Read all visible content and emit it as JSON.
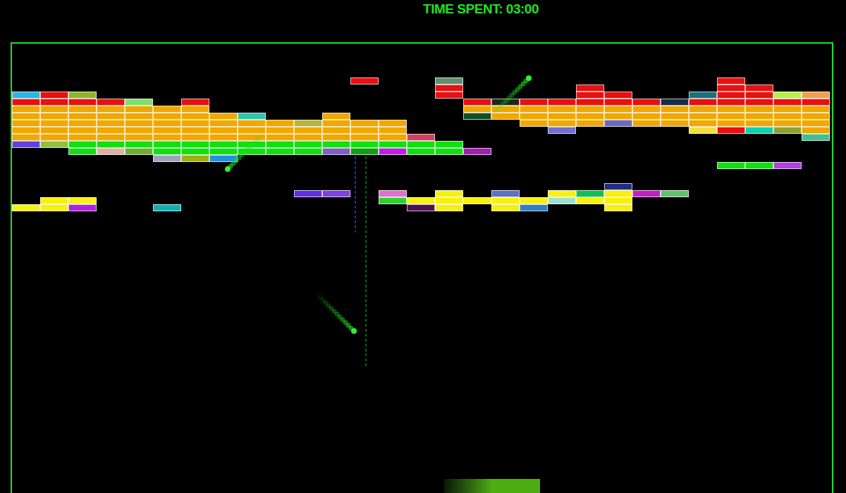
{
  "hud": {
    "time_label": "TIME SPENT: 03:00"
  },
  "bricks": [
    [
      null,
      null,
      null,
      null,
      null,
      null,
      null,
      null,
      null,
      null,
      null,
      null,
      "#e81010",
      null,
      null,
      "#5f8f6f",
      null,
      null,
      null,
      null,
      null,
      null,
      null,
      null,
      null,
      "#e81010",
      null,
      null,
      null
    ],
    [
      null,
      null,
      null,
      null,
      null,
      null,
      null,
      null,
      null,
      null,
      null,
      null,
      null,
      null,
      null,
      "#e81010",
      null,
      null,
      null,
      null,
      "#e81010",
      null,
      null,
      null,
      null,
      "#e81010",
      "#e81010",
      null,
      null
    ],
    [
      "#2cb5e0",
      "#e81010",
      "#8fb52a",
      null,
      null,
      null,
      null,
      null,
      null,
      null,
      null,
      null,
      null,
      null,
      null,
      "#e81010",
      null,
      null,
      null,
      null,
      "#e81010",
      "#e81010",
      null,
      null,
      "#1d6f7a",
      "#e81010",
      "#e81010",
      "#b5f04a",
      "#f0a050"
    ],
    [
      "#e81010",
      "#e81010",
      "#e81010",
      "#e81010",
      "#7ee06a",
      null,
      "#e81010",
      null,
      null,
      null,
      null,
      null,
      null,
      null,
      null,
      null,
      "#e81010",
      "#1a2a1a",
      "#e81010",
      "#e81010",
      "#e81010",
      "#e81010",
      "#e81010",
      "#1a2a4a",
      "#e81010",
      "#e81010",
      "#e81010",
      "#e81010",
      "#e81010"
    ],
    [
      "#f0a800",
      "#f0a800",
      "#f0a800",
      "#f0a800",
      "#f0a800",
      "#f0a800",
      "#f0a800",
      null,
      null,
      null,
      null,
      null,
      null,
      null,
      null,
      null,
      "#f0a800",
      "#f0a800",
      "#f0a800",
      "#f0a800",
      "#f0a800",
      "#f0a800",
      "#f0a800",
      "#f0a800",
      "#f0a800",
      "#f0a800",
      "#f0a800",
      "#f0a800",
      "#f0a800"
    ],
    [
      "#f0a800",
      "#f0a800",
      "#f0a800",
      "#f0a800",
      "#f0a800",
      "#f0a800",
      "#f0a800",
      "#f0a800",
      "#2ec4b0",
      null,
      null,
      "#f0a800",
      null,
      null,
      null,
      null,
      "#0f4f2a",
      "#f0a800",
      "#f0a800",
      "#f0a800",
      "#f0a800",
      "#f0a800",
      "#f0a800",
      "#f0a800",
      "#f0a800",
      "#f0a800",
      "#f0a800",
      "#f0a800",
      "#f0a800"
    ],
    [
      "#f0a800",
      "#f0a800",
      "#f0a800",
      "#f0a800",
      "#f0a800",
      "#f0a800",
      "#f0a800",
      "#f0a800",
      "#f0a800",
      "#f0a800",
      "#b5b53a",
      "#f0a800",
      "#f0a800",
      "#f0a800",
      null,
      null,
      null,
      null,
      "#f0a800",
      "#f0a800",
      "#f0a800",
      "#6a6aba",
      "#f0a800",
      "#f0a800",
      "#f0a800",
      "#f0a800",
      "#f0a800",
      "#f0a800",
      "#f0a800"
    ],
    [
      "#f0a800",
      "#f0a800",
      "#f0a800",
      "#f0a800",
      "#f0a800",
      "#f0a800",
      "#f0a800",
      "#f0a800",
      "#f0a800",
      "#f0a800",
      "#f0a800",
      "#f0a800",
      "#f0a800",
      "#f0a800",
      null,
      null,
      null,
      null,
      null,
      "#7070d0",
      null,
      null,
      null,
      null,
      "#f0e040",
      "#e81010",
      "#10d0b0",
      "#90a030",
      "#f0a800"
    ],
    [
      "#f0a800",
      "#f0a800",
      "#f0a800",
      "#f0a800",
      "#f0a800",
      "#f0a800",
      "#f0a800",
      "#f0a800",
      "#f0a800",
      "#f0a800",
      "#f0a800",
      "#f0a800",
      "#f0a800",
      "#f0a800",
      "#d04060",
      null,
      null,
      null,
      null,
      null,
      null,
      null,
      null,
      null,
      null,
      null,
      null,
      null,
      "#40c090"
    ],
    [
      "#6040e0",
      "#90c040",
      "#10e010",
      "#10e010",
      "#10e010",
      "#10e010",
      "#10e010",
      "#10e010",
      "#10e010",
      "#10e010",
      "#10e010",
      "#10e010",
      "#10e010",
      "#10e010",
      "#10e010",
      "#10e010",
      null,
      null,
      null,
      null,
      null,
      null,
      null,
      null,
      null,
      null,
      null,
      null,
      null
    ],
    [
      null,
      null,
      "#10e010",
      "#e0b0a0",
      "#70b030",
      "#10e010",
      "#10e010",
      "#10e010",
      "#10e010",
      "#10e010",
      "#10e010",
      "#8060c0",
      "#10a010",
      "#c020e0",
      "#10e010",
      "#10e010",
      "#a020b0",
      null,
      null,
      null,
      null,
      null,
      null,
      null,
      null,
      null,
      null,
      null,
      null
    ],
    [
      null,
      null,
      null,
      null,
      null,
      "#a0a0c0",
      "#a0b010",
      "#2090e0",
      null,
      null,
      null,
      null,
      null,
      null,
      null,
      null,
      null,
      null,
      null,
      null,
      null,
      null,
      null,
      null,
      null,
      null,
      null,
      null,
      null
    ],
    [
      null,
      null,
      null,
      null,
      null,
      null,
      null,
      null,
      null,
      null,
      null,
      null,
      null,
      null,
      null,
      null,
      null,
      null,
      null,
      null,
      null,
      null,
      null,
      null,
      null,
      "#10e010",
      "#10e010",
      "#b040e0",
      null
    ],
    [
      null,
      null,
      null,
      null,
      null,
      null,
      null,
      null,
      null,
      null,
      null,
      null,
      null,
      null,
      null,
      null,
      null,
      null,
      null,
      null,
      null,
      null,
      null,
      null,
      null,
      null,
      null,
      null,
      null
    ],
    [
      null,
      null,
      null,
      null,
      null,
      null,
      null,
      null,
      null,
      null,
      null,
      null,
      null,
      null,
      null,
      null,
      null,
      null,
      null,
      null,
      null,
      null,
      null,
      null,
      null,
      null,
      null,
      null,
      null
    ],
    [
      null,
      null,
      null,
      null,
      null,
      null,
      null,
      null,
      null,
      null,
      null,
      null,
      null,
      null,
      null,
      null,
      null,
      null,
      null,
      null,
      null,
      "#203080",
      null,
      null,
      null,
      null,
      null,
      null,
      null
    ],
    [
      null,
      null,
      null,
      null,
      null,
      null,
      null,
      null,
      null,
      null,
      "#6030e0",
      "#8040e0",
      null,
      "#e070d0",
      null,
      "#f8f010",
      null,
      "#6070c0",
      null,
      "#f8f010",
      "#10c050",
      "#f8f010",
      "#c020c0",
      "#60c070",
      null,
      null,
      null,
      null,
      null
    ],
    [
      null,
      "#f8f010",
      "#f8f010",
      null,
      null,
      null,
      null,
      null,
      null,
      null,
      null,
      null,
      null,
      "#30d030",
      "#f8f010",
      "#f8f010",
      "#f8f010",
      "#f8f010",
      "#f8f010",
      "#a0e0d0",
      "#f8f010",
      "#f8f010",
      null,
      null,
      null,
      null,
      null,
      null,
      null
    ],
    [
      "#f8f010",
      "#f8f010",
      "#b020e0",
      null,
      null,
      "#10b0b0",
      null,
      null,
      null,
      null,
      null,
      null,
      null,
      null,
      "#501050",
      "#f8f010",
      null,
      "#f8f010",
      "#3080c0",
      null,
      null,
      "#f8f010",
      null,
      null,
      null,
      null,
      null,
      null,
      null
    ]
  ]
}
